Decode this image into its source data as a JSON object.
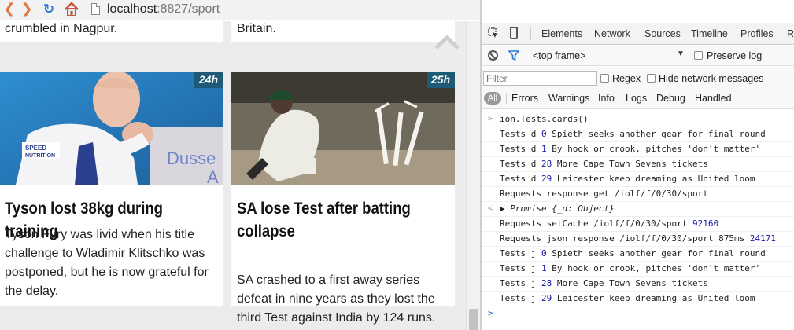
{
  "browser": {
    "url_host": "localhost",
    "url_port": ":8827",
    "url_path": "/sport"
  },
  "page": {
    "prev_cards": [
      {
        "text": "crumbled in Nagpur."
      },
      {
        "text": "Britain."
      }
    ],
    "cards": [
      {
        "badge": "24h",
        "title": "Tyson lost 38kg during training",
        "text": "Tyson Fury was livid when his title challenge to Wladimir Klitschko was postponed, but he is now grateful for the delay.",
        "photo_text": "Dusse",
        "photo_text2": "A",
        "shirt_text1": "SPEED",
        "shirt_text2": "NUTRITION"
      },
      {
        "badge": "25h",
        "title": "SA lose Test after batting collapse",
        "text": "SA crashed to a first away series defeat in nine years as they lost the third Test against India by 124 runs."
      }
    ]
  },
  "devtools": {
    "tabs": [
      "Elements",
      "Network",
      "Sources",
      "Timeline",
      "Profiles",
      "Re"
    ],
    "frame": "<top frame>",
    "preserve_log": "Preserve log",
    "filter_placeholder": "Filter",
    "regex": "Regex",
    "hide_network": "Hide network messages",
    "levels": [
      "All",
      "Errors",
      "Warnings",
      "Info",
      "Logs",
      "Debug",
      "Handled"
    ],
    "console": [
      {
        "gutter": ">",
        "text": "ion.Tests.cards()"
      },
      {
        "gutter": "",
        "text": "Tests d ",
        "num": "0",
        "rest": " Spieth seeks another gear for final round"
      },
      {
        "gutter": "",
        "text": "Tests d ",
        "num": "1",
        "rest": " By hook or crook, pitches 'don't matter'"
      },
      {
        "gutter": "",
        "text": "Tests d ",
        "num": "28",
        "rest": " More Cape Town Sevens tickets"
      },
      {
        "gutter": "",
        "text": "Tests d ",
        "num": "29",
        "rest": " Leicester keep dreaming as United loom"
      },
      {
        "gutter": "",
        "text": "Requests response get /iolf/f/0/30/sport"
      },
      {
        "gutter": "<",
        "text": "▶ Promise {_d: Object}"
      },
      {
        "gutter": "",
        "text": "Requests setCache /iolf/f/0/30/sport ",
        "num": "92160"
      },
      {
        "gutter": "",
        "text": "Requests json response /iolf/f/0/30/sport 875ms ",
        "num": "24171"
      },
      {
        "gutter": "",
        "text": "Tests j ",
        "num": "0",
        "rest": " Spieth seeks another gear for final round"
      },
      {
        "gutter": "",
        "text": "Tests j ",
        "num": "1",
        "rest": " By hook or crook, pitches 'don't matter'"
      },
      {
        "gutter": "",
        "text": "Tests j ",
        "num": "28",
        "rest": " More Cape Town Sevens tickets"
      },
      {
        "gutter": "",
        "text": "Tests j ",
        "num": "29",
        "rest": " Leicester keep dreaming as United loom"
      }
    ],
    "prompt": ">"
  },
  "colors": {
    "nav_arrows": "#e2783d",
    "reload": "#2e7bd6",
    "badge_bg": "#1d5a76",
    "console_number": "#1a1aa6",
    "photo1_bg": "#2a7fc0",
    "photo2_bg": "#6f6a5c"
  }
}
